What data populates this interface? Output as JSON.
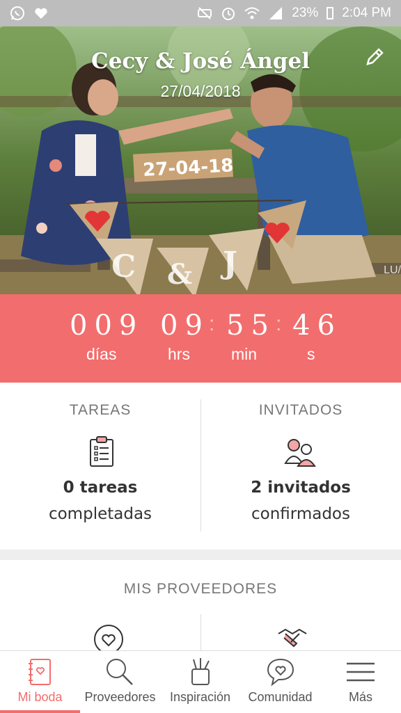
{
  "status_bar": {
    "left_icons": [
      "whatsapp-icon",
      "heart-icon"
    ],
    "right_icons": [
      "mute-icon",
      "alarm-icon",
      "wifi-icon",
      "signal-icon"
    ],
    "battery": "23%",
    "time": "2:04 PM"
  },
  "hero": {
    "couple": "Cecy & José Ángel",
    "date": "27/04/2018",
    "sign_text": "27-04-18",
    "banner_letters": [
      "C",
      "&",
      "J"
    ],
    "watermark": "LU/"
  },
  "countdown": {
    "days": "009",
    "hours": "09",
    "minutes": "55",
    "seconds": "46",
    "days_label": "días",
    "hours_label": "hrs",
    "minutes_label": "min",
    "seconds_label": "s"
  },
  "tasks": {
    "title": "TAREAS",
    "count": "0 tareas",
    "label": "completadas"
  },
  "guests": {
    "title": "INVITADOS",
    "count": "2 invitados",
    "label": "confirmados"
  },
  "providers": {
    "title": "MIS PROVEEDORES"
  },
  "nav": {
    "items": [
      "Mi boda",
      "Proveedores",
      "Inspiración",
      "Comunidad",
      "Más"
    ],
    "active": "Mi boda"
  },
  "colors": {
    "accent": "#f26d6d",
    "status_bar": "#bdbdbd",
    "divider": "#eeeeee"
  }
}
